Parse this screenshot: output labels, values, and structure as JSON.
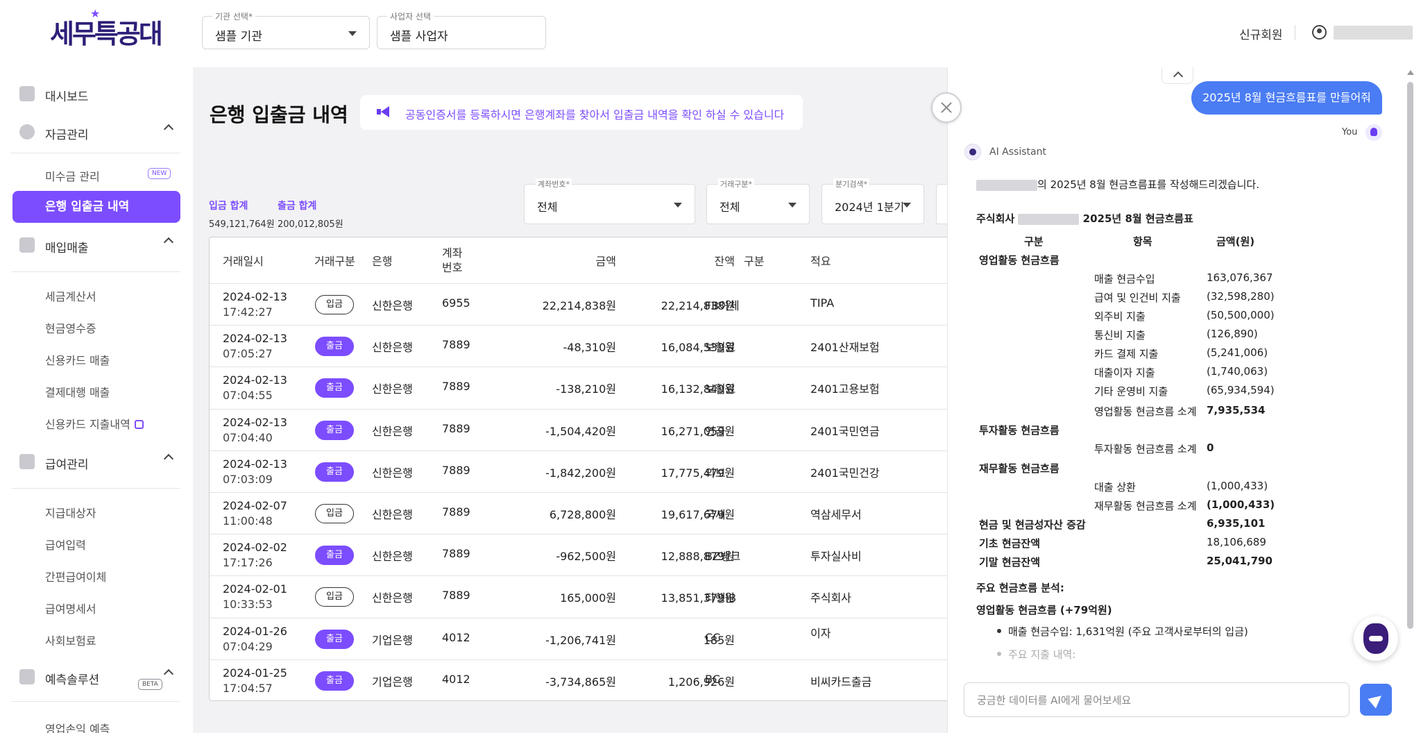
{
  "header": {
    "logo_text": "세무특공대",
    "org_select": {
      "label": "기관 선택*",
      "value": "샘플 기관"
    },
    "biz_select": {
      "label": "사업자 선택",
      "value": "샘플 사업자"
    },
    "new_member": "신규회원"
  },
  "sidebar": {
    "dashboard": "대시보드",
    "fund_group": "자금관리",
    "fund_items": [
      "미수금 관리",
      "은행 입출금 내역"
    ],
    "new_badge": "NEW",
    "sales_group": "매입매출",
    "sales_items": [
      "세금계산서",
      "현금영수증",
      "신용카드 매출",
      "결제대행 매출",
      "신용카드 지출내역"
    ],
    "payroll_group": "급여관리",
    "payroll_items": [
      "지급대상자",
      "급여입력",
      "간편급여이체",
      "급여명세서",
      "사회보험료"
    ],
    "forecast_group": "예측솔루션",
    "beta_badge": "BETA",
    "forecast_items": [
      "영업손익 예측"
    ]
  },
  "main": {
    "title": "은행 입출금 내역",
    "notice": "공동인증서를 등록하시면 은행계좌를 찾아서 입출금 내역을 확인 하실 수 있습니다",
    "deposit_total_label": "입금 합계",
    "deposit_total_value": "549,121,764원",
    "withdraw_total_label": "출금 합계",
    "withdraw_total_value": "200,012,805원",
    "filters": [
      {
        "label": "계좌번호*",
        "value": "전체"
      },
      {
        "label": "거래구분*",
        "value": "전체"
      },
      {
        "label": "분기검색*",
        "value": "2024년 1분기"
      }
    ],
    "table": {
      "headers": [
        "거래일시",
        "거래구분",
        "은행",
        "계좌\n번호",
        "금액",
        "잔액",
        "구분",
        "적요"
      ],
      "rows": [
        {
          "date": "2024-02-13",
          "time": "17:42:27",
          "type": "입금",
          "dir": "in",
          "bank": "신한은행",
          "acct": "6955",
          "amount": "22,214,838원",
          "balance": "22,214,838원",
          "cat": "FB이체",
          "memo": "TIPA"
        },
        {
          "date": "2024-02-13",
          "time": "07:05:27",
          "type": "출금",
          "dir": "out",
          "bank": "신한은행",
          "acct": "7889",
          "amount": "-48,310원",
          "balance": "16,084,539원",
          "cat": "보험료",
          "memo": "2401산재보험"
        },
        {
          "date": "2024-02-13",
          "time": "07:04:55",
          "type": "출금",
          "dir": "out",
          "bank": "신한은행",
          "acct": "7889",
          "amount": "-138,210원",
          "balance": "16,132,849원",
          "cat": "보험료",
          "memo": "2401고용보험"
        },
        {
          "date": "2024-02-13",
          "time": "07:04:40",
          "type": "출금",
          "dir": "out",
          "bank": "신한은행",
          "acct": "7889",
          "amount": "-1,504,420원",
          "balance": "16,271,059원",
          "cat": "연금",
          "memo": "2401국민연금"
        },
        {
          "date": "2024-02-13",
          "time": "07:03:09",
          "type": "출금",
          "dir": "out",
          "bank": "신한은행",
          "acct": "7889",
          "amount": "-1,842,200원",
          "balance": "17,775,479원",
          "cat": "의보",
          "memo": "2401국민건강"
        },
        {
          "date": "2024-02-07",
          "time": "11:00:48",
          "type": "입금",
          "dir": "in",
          "bank": "신한은행",
          "acct": "7889",
          "amount": "6,728,800원",
          "balance": "19,617,679원",
          "cat": "국세",
          "memo": "역삼세무서"
        },
        {
          "date": "2024-02-02",
          "time": "17:17:26",
          "type": "출금",
          "dir": "out",
          "bank": "신한은행",
          "acct": "7889",
          "amount": "-962,500원",
          "balance": "12,888,879원",
          "cat": "BZ뱅크",
          "memo": "투자실사비"
        },
        {
          "date": "2024-02-01",
          "time": "10:33:53",
          "type": "입금",
          "dir": "in",
          "bank": "신한은행",
          "acct": "7889",
          "amount": "165,000원",
          "balance": "13,851,379원",
          "cat": "타행IB",
          "memo": "주식회사"
        },
        {
          "date": "2024-01-26",
          "time": "07:04:29",
          "type": "출금",
          "dir": "out",
          "bank": "기업은행",
          "acct": "4012",
          "amount": "-1,206,741원",
          "balance": "185원",
          "cat": "CC",
          "memo": "이자"
        },
        {
          "date": "2024-01-25",
          "time": "17:04:57",
          "type": "출금",
          "dir": "out",
          "bank": "기업은행",
          "acct": "4012",
          "amount": "-3,734,865원",
          "balance": "1,206,926원",
          "cat": "BC",
          "memo": "비씨카드출금"
        }
      ]
    }
  },
  "chat": {
    "user_message": "2025년 8월 현금흐름표를 만들어줘",
    "user_label": "You",
    "ai_label": "AI Assistant",
    "intro_suffix": "의 2025년 8월 현금흐름표를 작성해드리겠습니다.",
    "report_prefix": "주식회사",
    "report_title_suffix": "2025년 8월 현금흐름표",
    "col_headers": [
      "구분",
      "항목",
      "금액(원)"
    ],
    "operating": {
      "title": "영업활동 현금흐름",
      "items": [
        {
          "name": "매출 현금수입",
          "value": "163,076,367"
        },
        {
          "name": "급여 및 인건비 지출",
          "value": "(32,598,280)"
        },
        {
          "name": "외주비 지출",
          "value": "(50,500,000)"
        },
        {
          "name": "통신비 지출",
          "value": "(126,890)"
        },
        {
          "name": "카드 결제 지출",
          "value": "(5,241,006)"
        },
        {
          "name": "대출이자 지출",
          "value": "(1,740,063)"
        },
        {
          "name": "기타 운영비 지출",
          "value": "(65,934,594)"
        }
      ],
      "subtotal_label": "영업활동 현금흐름 소계",
      "subtotal_value": "7,935,534"
    },
    "investing": {
      "title": "투자활동 현금흐름",
      "subtotal_label": "투자활동 현금흐름 소계",
      "subtotal_value": "0"
    },
    "financing": {
      "title": "재무활동 현금흐름",
      "item_name": "대출 상환",
      "item_value": "(1,000,433)",
      "subtotal_label": "재무활동 현금흐름 소계",
      "subtotal_value": "(1,000,433)"
    },
    "net_change_label": "현금 및 현금성자산 증감",
    "net_change_value": "6,935,101",
    "opening_label": "기초 현금잔액",
    "opening_value": "18,106,689",
    "closing_label": "기말 현금잔액",
    "closing_value": "25,041,790",
    "analysis_title": "주요 현금흐름 분석:",
    "analysis_sub": "영업활동 현금흐름 (+79억원)",
    "analysis_bullet_1": "매출 현금수입: 1,631억원 (주요 고객사로부터의 입금)",
    "analysis_bullet_2": "주요 지출 내역:",
    "input_placeholder": "궁금한 데이터를 AI에게 물어보세요"
  },
  "colors": {
    "accent": "#7c4dff",
    "chat_blue": "#4a7cf3",
    "logo": "#2d1f78"
  }
}
